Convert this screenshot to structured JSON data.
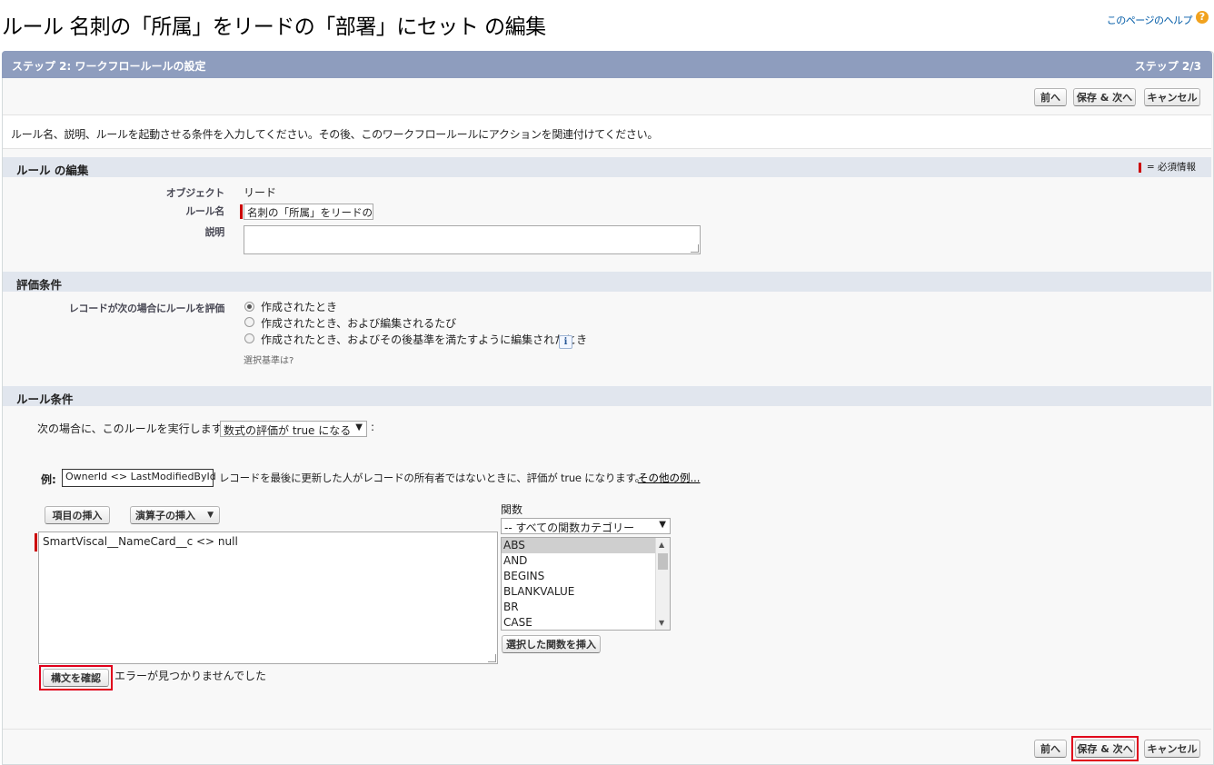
{
  "page": {
    "title": "ルール 名刺の「所属」をリードの「部署」にセット の編集",
    "help_link": "このページのヘルプ",
    "help_icon": "?"
  },
  "step": {
    "title": "ステップ 2: ワークフロールールの設定",
    "indicator": "ステップ 2/3"
  },
  "buttons": {
    "prev": "前へ",
    "save_next": "保存 & 次へ",
    "cancel": "キャンセル"
  },
  "instructions": "ルール名、説明、ルールを起動させる条件を入力してください。その後、このワークフロールールにアクションを関連付けてください。",
  "rule_edit": {
    "section_title": "ルール の編集",
    "required_legend": "= 必須情報",
    "object_label": "オブジェクト",
    "object_value": "リード",
    "rule_name_label": "ルール名",
    "rule_name_value": "名刺の「所属」をリードの「部署」にセット",
    "description_label": "説明",
    "description_value": ""
  },
  "evaluation": {
    "section_title": "評価条件",
    "label": "レコードが次の場合にルールを評価",
    "options": [
      {
        "label": "作成されたとき",
        "selected": true
      },
      {
        "label": "作成されたとき、および編集されるたび",
        "selected": false
      },
      {
        "label": "作成されたとき、およびその後基準を満たすように編集されたとき",
        "selected": false
      }
    ],
    "info_icon": "i",
    "help_text": "選択基準は?"
  },
  "rule_criteria": {
    "section_title": "ルール条件",
    "run_prefix": "次の場合に、このルールを実行します。",
    "run_select": "数式の評価が true になる",
    "run_suffix": ":",
    "example_label": "例:",
    "example_formula": "OwnerId <> LastModifiedById",
    "example_desc": "レコードを最後に更新した人がレコードの所有者ではないときに、評価が true になります。",
    "more_examples": "その他の例...",
    "insert_field": "項目の挿入",
    "insert_operator": "演算子の挿入",
    "formula": "SmartViscal__NameCard__c <> null",
    "functions_label": "関数",
    "functions_category": "-- すべての関数カテゴリー",
    "functions": [
      "ABS",
      "AND",
      "BEGINS",
      "BLANKVALUE",
      "BR",
      "CASE"
    ],
    "insert_function": "選択した関数を挿入",
    "check_syntax": "構文を確認",
    "syntax_result": "エラーが見つかりませんでした"
  },
  "colors": {
    "header_bar": "#8e9dbe",
    "section_bg": "#e1e6ee",
    "required_red": "#cc0000",
    "highlight_red": "#e0001b"
  }
}
